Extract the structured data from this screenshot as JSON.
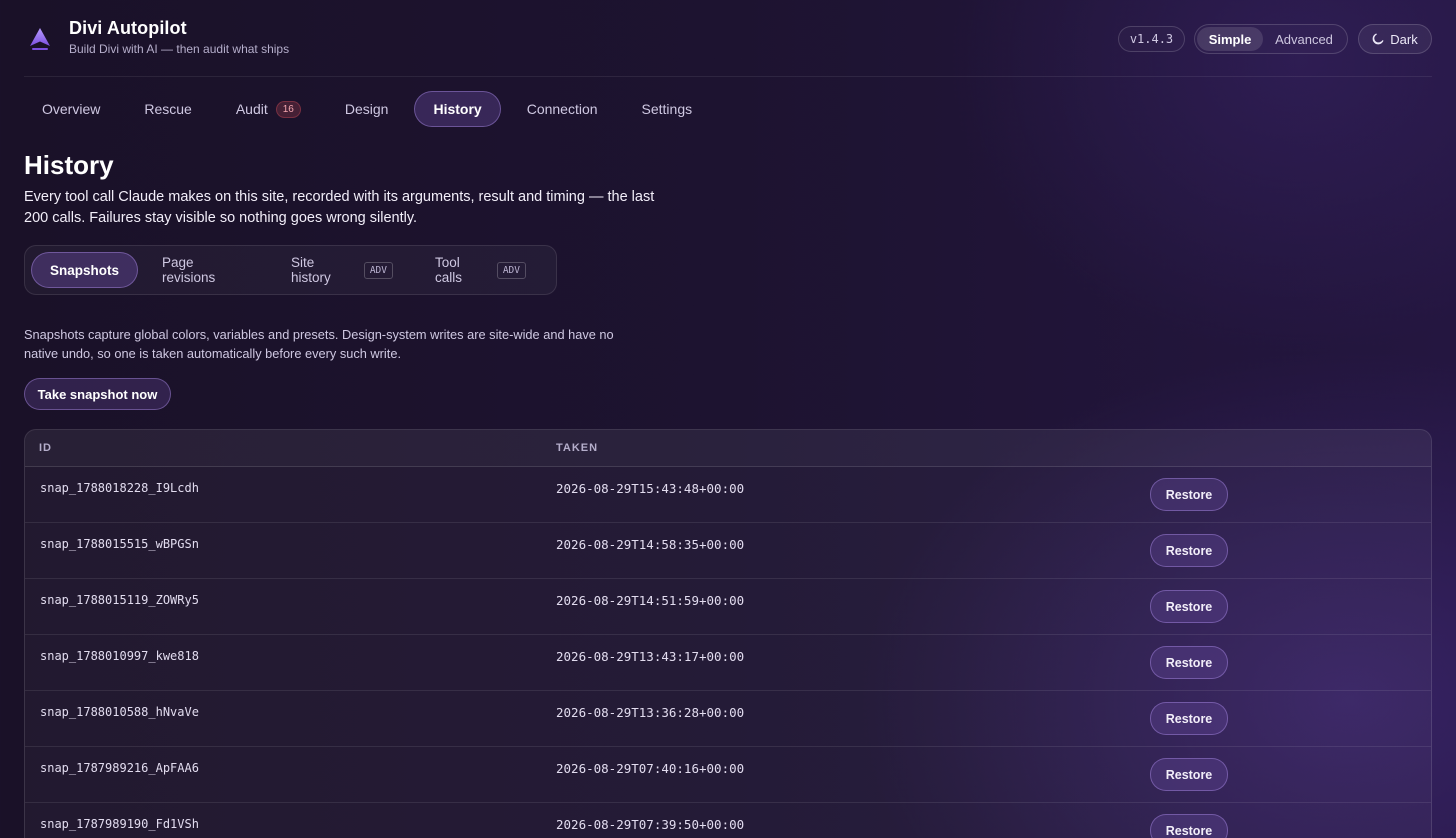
{
  "app": {
    "title": "Divi Autopilot",
    "subtitle": "Build Divi with AI — then audit what ships",
    "version": "v1.4.3"
  },
  "mode_toggle": {
    "options": [
      "Simple",
      "Advanced"
    ],
    "selected": "Simple"
  },
  "theme_button": {
    "label": "Dark",
    "icon": "moon-icon"
  },
  "nav": {
    "tabs": [
      {
        "label": "Overview"
      },
      {
        "label": "Rescue"
      },
      {
        "label": "Audit",
        "badge": "16"
      },
      {
        "label": "Design"
      },
      {
        "label": "History",
        "active": true
      },
      {
        "label": "Connection"
      },
      {
        "label": "Settings"
      }
    ]
  },
  "page": {
    "title": "History",
    "description": "Every tool call Claude makes on this site, recorded with its arguments, result and timing — the last 200 calls. Failures stay visible so nothing goes wrong silently."
  },
  "subtabs": [
    {
      "label": "Snapshots",
      "active": true
    },
    {
      "label": "Page revisions"
    },
    {
      "label": "Site history",
      "tag": "ADV"
    },
    {
      "label": "Tool calls",
      "tag": "ADV"
    }
  ],
  "snapshots": {
    "info": "Snapshots capture global colors, variables and presets. Design-system writes are site-wide and have no native undo, so one is taken automatically before every such write.",
    "take_button": "Take snapshot now",
    "columns": [
      "ID",
      "TAKEN"
    ],
    "restore_label": "Restore",
    "rows": [
      {
        "id": "snap_1788018228_I9Lcdh",
        "taken": "2026-08-29T15:43:48+00:00"
      },
      {
        "id": "snap_1788015515_wBPGSn",
        "taken": "2026-08-29T14:58:35+00:00"
      },
      {
        "id": "snap_1788015119_ZOWRy5",
        "taken": "2026-08-29T14:51:59+00:00"
      },
      {
        "id": "snap_1788010997_kwe818",
        "taken": "2026-08-29T13:43:17+00:00"
      },
      {
        "id": "snap_1788010588_hNvaVe",
        "taken": "2026-08-29T13:36:28+00:00"
      },
      {
        "id": "snap_1787989216_ApFAA6",
        "taken": "2026-08-29T07:40:16+00:00"
      },
      {
        "id": "snap_1787989190_Fd1VSh",
        "taken": "2026-08-29T07:39:50+00:00"
      }
    ]
  },
  "colors": {
    "accent": "#8a5cf0",
    "badge_red": "#f3a6ae"
  }
}
